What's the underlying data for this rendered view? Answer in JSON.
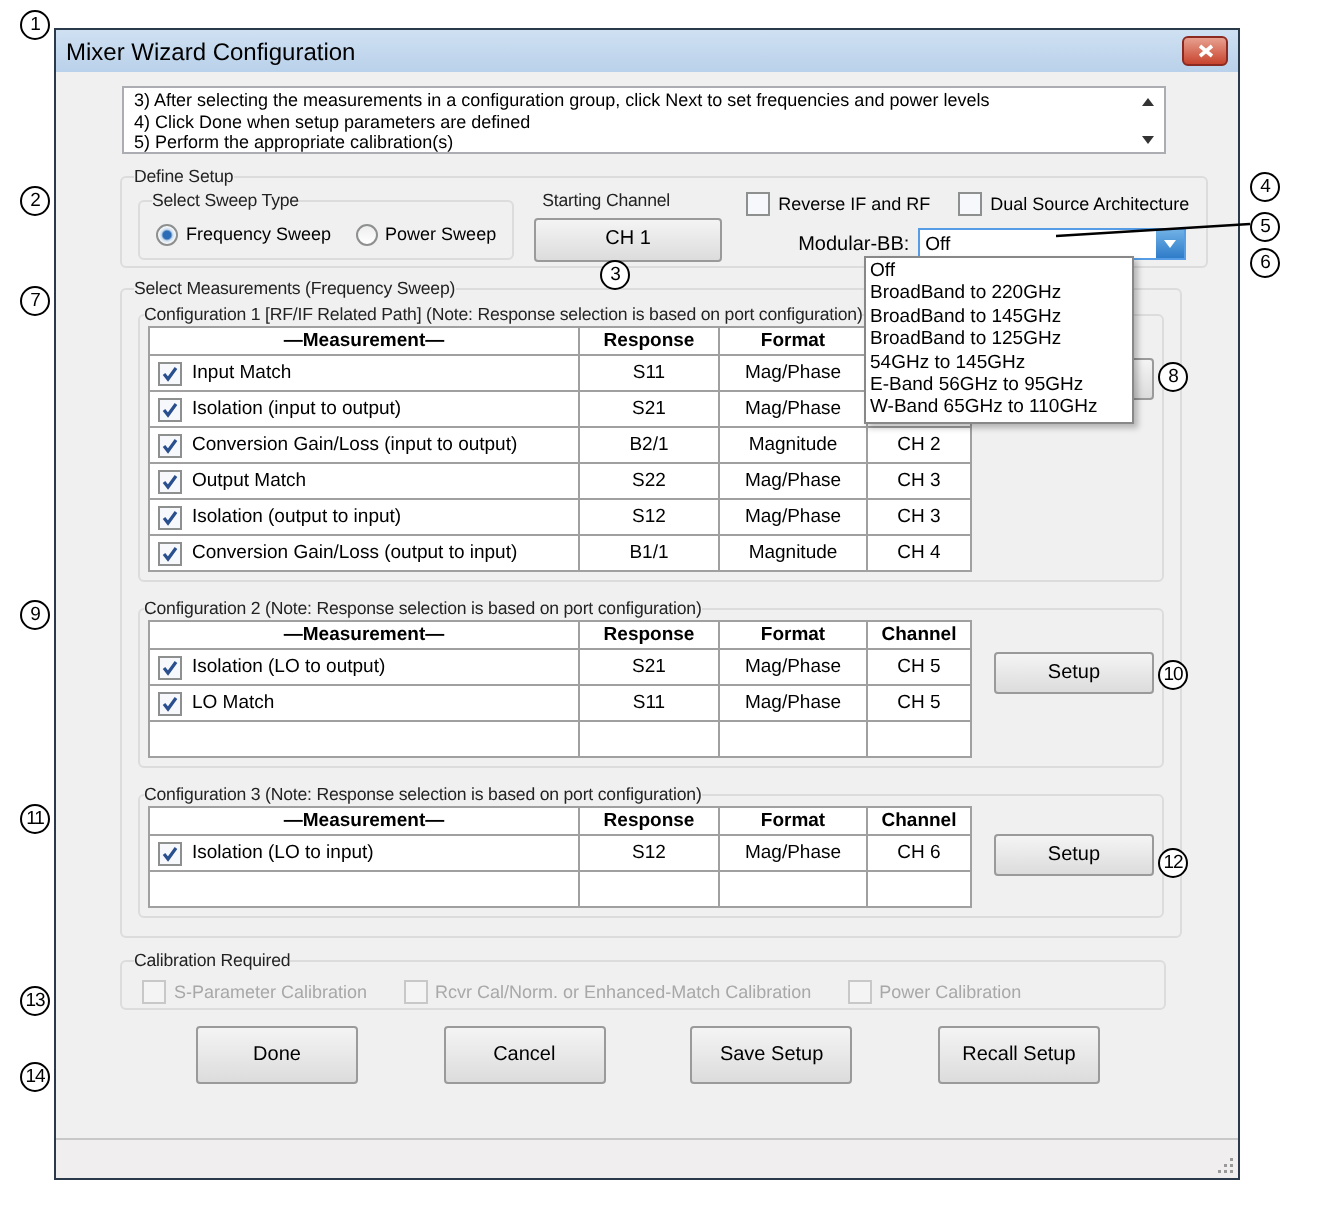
{
  "window": {
    "title": "Mixer Wizard Configuration"
  },
  "instructions": [
    "3) After selecting the measurements in a configuration group, click Next to set frequencies and power levels",
    "4) Click Done when setup parameters are defined",
    "5) Perform the appropriate calibration(s)"
  ],
  "define_setup": {
    "title": "Define Setup",
    "sweep_type": {
      "title": "Select Sweep Type",
      "options": [
        {
          "label": "Frequency Sweep",
          "selected": true
        },
        {
          "label": "Power Sweep",
          "selected": false
        }
      ]
    },
    "starting_channel": {
      "title": "Starting Channel",
      "button": "CH 1"
    },
    "options": [
      {
        "label": "Reverse IF and RF",
        "checked": false
      },
      {
        "label": "Dual Source Architecture",
        "checked": false
      }
    ],
    "modular_bb": {
      "label": "Modular-BB:",
      "value": "Off",
      "expanded": true,
      "items": [
        "Off",
        "BroadBand to 220GHz",
        "BroadBand to 145GHz",
        "BroadBand to 125GHz",
        "54GHz to 145GHz",
        "E-Band 56GHz to 95GHz",
        "W-Band 65GHz to 110GHz"
      ]
    }
  },
  "measurements": {
    "title": "Select Measurements (Frequency Sweep)",
    "configurations": [
      {
        "title": "Configuration 1 [RF/IF Related Path] (Note: Response selection is based on port configuration)",
        "columns": [
          "—Measurement—",
          "Response",
          "Format"
        ],
        "rows": [
          {
            "kind": "item",
            "checked": true,
            "measurement": "Input Match",
            "response": "S11",
            "format": "Mag/Phase"
          },
          {
            "kind": "item",
            "checked": true,
            "measurement": "Isolation (input to output)",
            "response": "S21",
            "format": "Mag/Phase"
          },
          {
            "kind": "item",
            "checked": true,
            "measurement": "Conversion Gain/Loss (input to output)",
            "response": "B2/1",
            "format": "Magnitude",
            "channel": "CH 2"
          },
          {
            "kind": "item",
            "checked": true,
            "measurement": "Output Match",
            "response": "S22",
            "format": "Mag/Phase",
            "channel": "CH 3"
          },
          {
            "kind": "item",
            "checked": true,
            "measurement": "Isolation (output to input)",
            "response": "S12",
            "format": "Mag/Phase",
            "channel": "CH 3"
          },
          {
            "kind": "item",
            "checked": true,
            "measurement": "Conversion Gain/Loss (output to input)",
            "response": "B1/1",
            "format": "Magnitude",
            "channel": "CH 4"
          }
        ]
      },
      {
        "title": "Configuration 2 (Note: Response selection is based on port configuration)",
        "columns": [
          "—Measurement—",
          "Response",
          "Format",
          "Channel"
        ],
        "setup_button": "Setup",
        "rows": [
          {
            "kind": "item",
            "checked": true,
            "measurement": "Isolation (LO to output)",
            "response": "S21",
            "format": "Mag/Phase",
            "channel": "CH 5"
          },
          {
            "kind": "item",
            "checked": true,
            "measurement": "LO Match",
            "response": "S11",
            "format": "Mag/Phase",
            "channel": "CH 5"
          },
          {
            "kind": "blank"
          }
        ]
      },
      {
        "title": "Configuration 3 (Note: Response selection is based on port configuration)",
        "columns": [
          "—Measurement—",
          "Response",
          "Format",
          "Channel"
        ],
        "setup_button": "Setup",
        "rows": [
          {
            "kind": "item",
            "checked": true,
            "measurement": "Isolation (LO to input)",
            "response": "S12",
            "format": "Mag/Phase",
            "channel": "CH 6"
          },
          {
            "kind": "blank"
          }
        ]
      }
    ]
  },
  "calibration": {
    "title": "Calibration Required",
    "options": [
      {
        "label": "S-Parameter Calibration",
        "checked": false,
        "disabled": true
      },
      {
        "label": "Rcvr Cal/Norm. or Enhanced-Match Calibration",
        "checked": false,
        "disabled": true
      },
      {
        "label": "Power Calibration",
        "checked": false,
        "disabled": true
      }
    ]
  },
  "buttons": [
    "Done",
    "Cancel",
    "Save Setup",
    "Recall Setup"
  ],
  "callouts": [
    "1",
    "2",
    "3",
    "4",
    "5",
    "6",
    "7",
    "8",
    "9",
    "10",
    "11",
    "12",
    "13",
    "14"
  ]
}
